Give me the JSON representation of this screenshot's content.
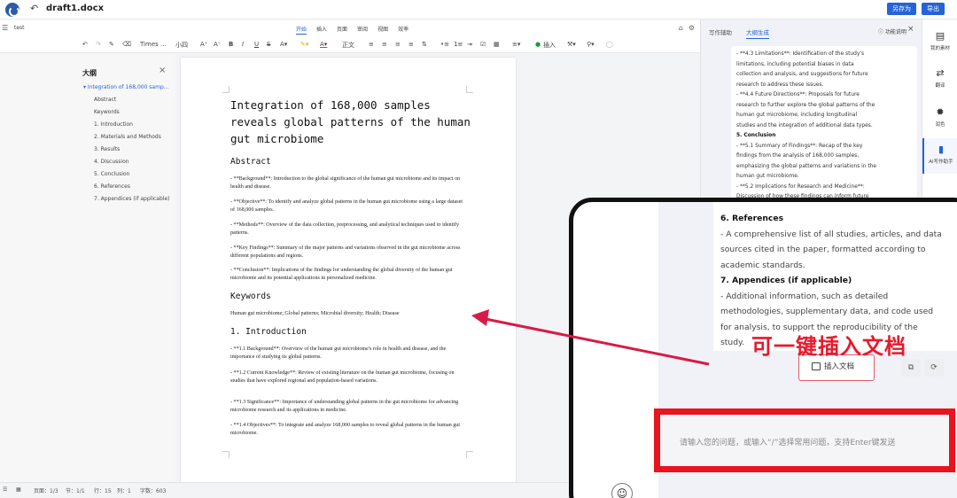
{
  "titlebar": {
    "doc_name": "draft1.docx",
    "save_as": "另存为",
    "export": "导出"
  },
  "tabbar": {
    "file_label": "test",
    "tabs": [
      "开始",
      "插入",
      "页面",
      "审阅",
      "视图",
      "效率"
    ],
    "active_tab": "开始"
  },
  "toolbar": {
    "font_name": "Times ...",
    "font_size": "小四",
    "paragraph_label": "正文",
    "insert_label": "插入"
  },
  "outline": {
    "title": "大纲",
    "items": [
      "Integration of 168,000 samp...",
      "Abstract",
      "Keywords",
      "1. Introduction",
      "2. Materials and Methods",
      "3. Results",
      "4. Discussion",
      "5. Conclusion",
      "6. References",
      "7. Appendices (if applicable)"
    ]
  },
  "document": {
    "title": "Integration of 168,000 samples reveals global patterns of the human gut microbiome",
    "abstract_heading": "Abstract",
    "abstract": [
      "- **Background**: Introduction to the global significance of the human gut microbiome and its impact on health and disease.",
      "- **Objective**: To identify and analyze global patterns in the human gut microbiome using a large dataset of 168,000 samples.",
      "- **Methods**: Overview of the data collection, preprocessing, and analytical techniques used to identify patterns.",
      "- **Key Findings**: Summary of the major patterns and variations observed in the gut microbiome across different populations and regions.",
      "- **Conclusion**: Implications of the findings for understanding the global diversity of the human gut microbiome and its potential applications in personalized medicine."
    ],
    "keywords_heading": "Keywords",
    "keywords": "Human gut microbiome; Global patterns; Microbial diversity; Health; Disease",
    "intro_heading": "1.  Introduction",
    "intro": [
      "- **1.1 Background**: Overview of the human gut microbiome's role in health and disease, and the importance of studying its global patterns.",
      "- **1.2 Current Knowledge**: Review of existing literature on the human gut microbiome, focusing on studies that have explored regional and population-based variations.",
      "- **1.3 Significance**: Importance of understanding global patterns in the gut microbiome for advancing microbiome research and its applications in medicine.",
      "- **1.4 Objectives**: To integrate and analyze 168,000 samples to reveal global patterns in the human gut microbiome."
    ]
  },
  "statusbar": {
    "page": "页面：1/3",
    "section": "节：1/1",
    "row": "行：15",
    "col": "列：1",
    "words": "字数：603"
  },
  "ai_panel": {
    "tab_writing": "写作辅助",
    "tab_outline": "大纲生成",
    "help": "功能说明",
    "lines": [
      "- **4.3 Limitations**: Identification of the study's",
      "limitations, including potential biases in data",
      "collection and analysis, and suggestions for future",
      "research to address these issues.",
      "- **4.4 Future Directions**: Proposals for future",
      "research to further explore the global patterns of the",
      "human gut microbiome, including longitudinal",
      "studies and the integration of additional data types.",
      "5. Conclusion",
      "- **5.1 Summary of Findings**: Recap of the key",
      "findings from the analysis of 168,000 samples,",
      "emphasizing the global patterns and variations in the",
      "human gut microbiome.",
      "- **5.2 Implications for Research and Medicine**:",
      "Discussion of how these findings can inform future"
    ]
  },
  "right_sidebar": {
    "items": [
      "我的素材",
      "翻译",
      "润色",
      "AI写作助手"
    ]
  },
  "zoom": {
    "lines": [
      "6. References",
      "- A comprehensive list of all studies, articles, and data",
      "sources cited in the paper, formatted according to",
      "academic standards.",
      "7. Appendices (if applicable)",
      "- Additional information, such as detailed",
      "methodologies, supplementary data, and code used",
      "for analysis, to support the reproducibility of the",
      "study."
    ],
    "insert_button": "插入文档",
    "callout": "可一键插入文档",
    "input_placeholder": "请输入您的问题，或输入“/”选择常用问题，支持Enter键发送"
  },
  "colors": {
    "accent": "#2563d8",
    "callout_red": "#e8192c"
  }
}
